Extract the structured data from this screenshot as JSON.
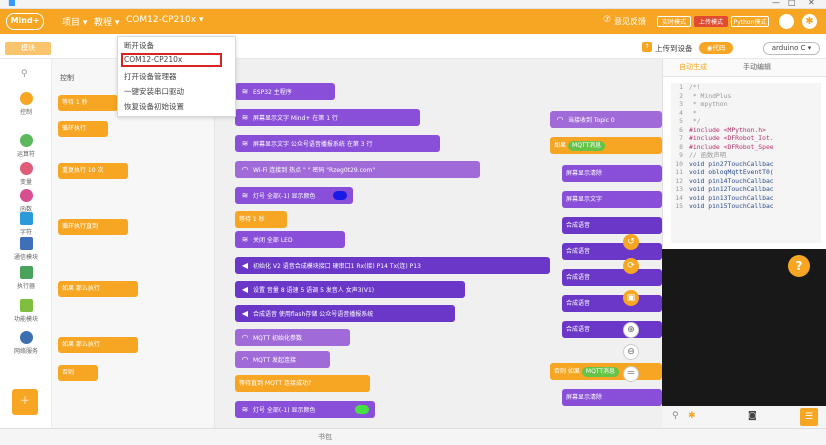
{
  "window": {
    "title": "Mind+"
  },
  "topbar": {
    "logo": "Mind+",
    "menu_project": "项目 ▾",
    "menu_tutorial": "教程 ▾",
    "menu_port": "COM12-CP210x ▾",
    "feedback": "意见反馈",
    "mode_realtime": "实时模式",
    "mode_upload": "上传模式",
    "mode_python": "Python模式"
  },
  "subbar": {
    "modules_tab": "模块",
    "upload_button": "上传到设备",
    "code_tab": "代码",
    "board_select": "arduino C ▾"
  },
  "dropdown": {
    "items": [
      "断开设备",
      "COM12-CP210x",
      "打开设备管理器",
      "一键安装串口驱动",
      "恢复设备初始设置"
    ]
  },
  "categories": [
    {
      "label": "控制",
      "color": "#f6a623"
    },
    {
      "label": "运算符",
      "color": "#5cb85c"
    },
    {
      "label": "变量",
      "color": "#e05d7a"
    },
    {
      "label": "函数",
      "color": "#d64f8f"
    },
    {
      "label": "字符",
      "color": "#2a9bd8"
    },
    {
      "label": "通信模块",
      "color": "#3f6fb6"
    },
    {
      "label": "执行器",
      "color": "#4aa35b"
    },
    {
      "label": "功能模块",
      "color": "#7fbf3f"
    },
    {
      "label": "网络服务",
      "color": "#3b6fb0"
    }
  ],
  "palette": {
    "title": "控制",
    "blocks": [
      "等待 1 秒",
      "循环执行",
      "重复执行 10 次",
      "循环执行直到",
      "如果 那么执行",
      "如果 那么执行",
      "否则"
    ]
  },
  "workspace": {
    "blocks": [
      "ESP32 主程序",
      "屏幕显示文字 Mind+ 在第 1 行",
      "屏幕显示文字 公众号语音播报系统 在第 3 行",
      "Wi-Fi 连接到 热点 \" \" 密码 \"Rzeg0t29.com\"",
      "灯号 全部(-1) 显示颜色",
      "等待 1 秒",
      "关闭 全部 LED",
      "初始化 V2 语音合成模块接口 硬串口1 Rx(接) P14 Tx(连) P13",
      "设置 音量 8 语速 5 语调 5 发音人 女声3(V1)",
      "合成语音 使用flash存储 公众号语音播报系统",
      "MQTT 初始化参数",
      "MQTT 发起连接",
      "等待直到 MQTT 连接成功?",
      "灯号 全部(-1) 显示颜色"
    ],
    "right_blocks": [
      "当接收到 Topic 0",
      "如果",
      "MQTT消息",
      "屏幕显示清除",
      "屏幕显示文字",
      "合成语音",
      "合成语音",
      "合成语音",
      "合成语音",
      "合成语音",
      "否则 如果",
      "MQTT消息",
      "屏幕显示清除"
    ]
  },
  "code_panel": {
    "tab_auto": "自动生成",
    "tab_manual": "手动编辑",
    "lines": [
      "/*!",
      " * MindPlus",
      " * mpython",
      " *",
      " */",
      "#include <MPython.h>",
      "#include <DFRobot_Iot.",
      "#include <DFRobot_Spee",
      "// 函数声明",
      "void pin27TouchCallbac",
      "void obloqMqttEventT0(",
      "void pin14TouchCallbac",
      "void pin12TouchCallbac",
      "void pin13TouchCallbac",
      "void pin15TouchCallbac"
    ]
  },
  "bottombar": {
    "label": "书包"
  },
  "colors": {
    "topbar": "#f6a623",
    "control": "#f6a623",
    "wifi": "#a06bd8",
    "purple_block": "#8a4fd8",
    "dark_purple": "#6a37c9",
    "green_block": "#65c347",
    "highlight_red": "#d7261e"
  }
}
